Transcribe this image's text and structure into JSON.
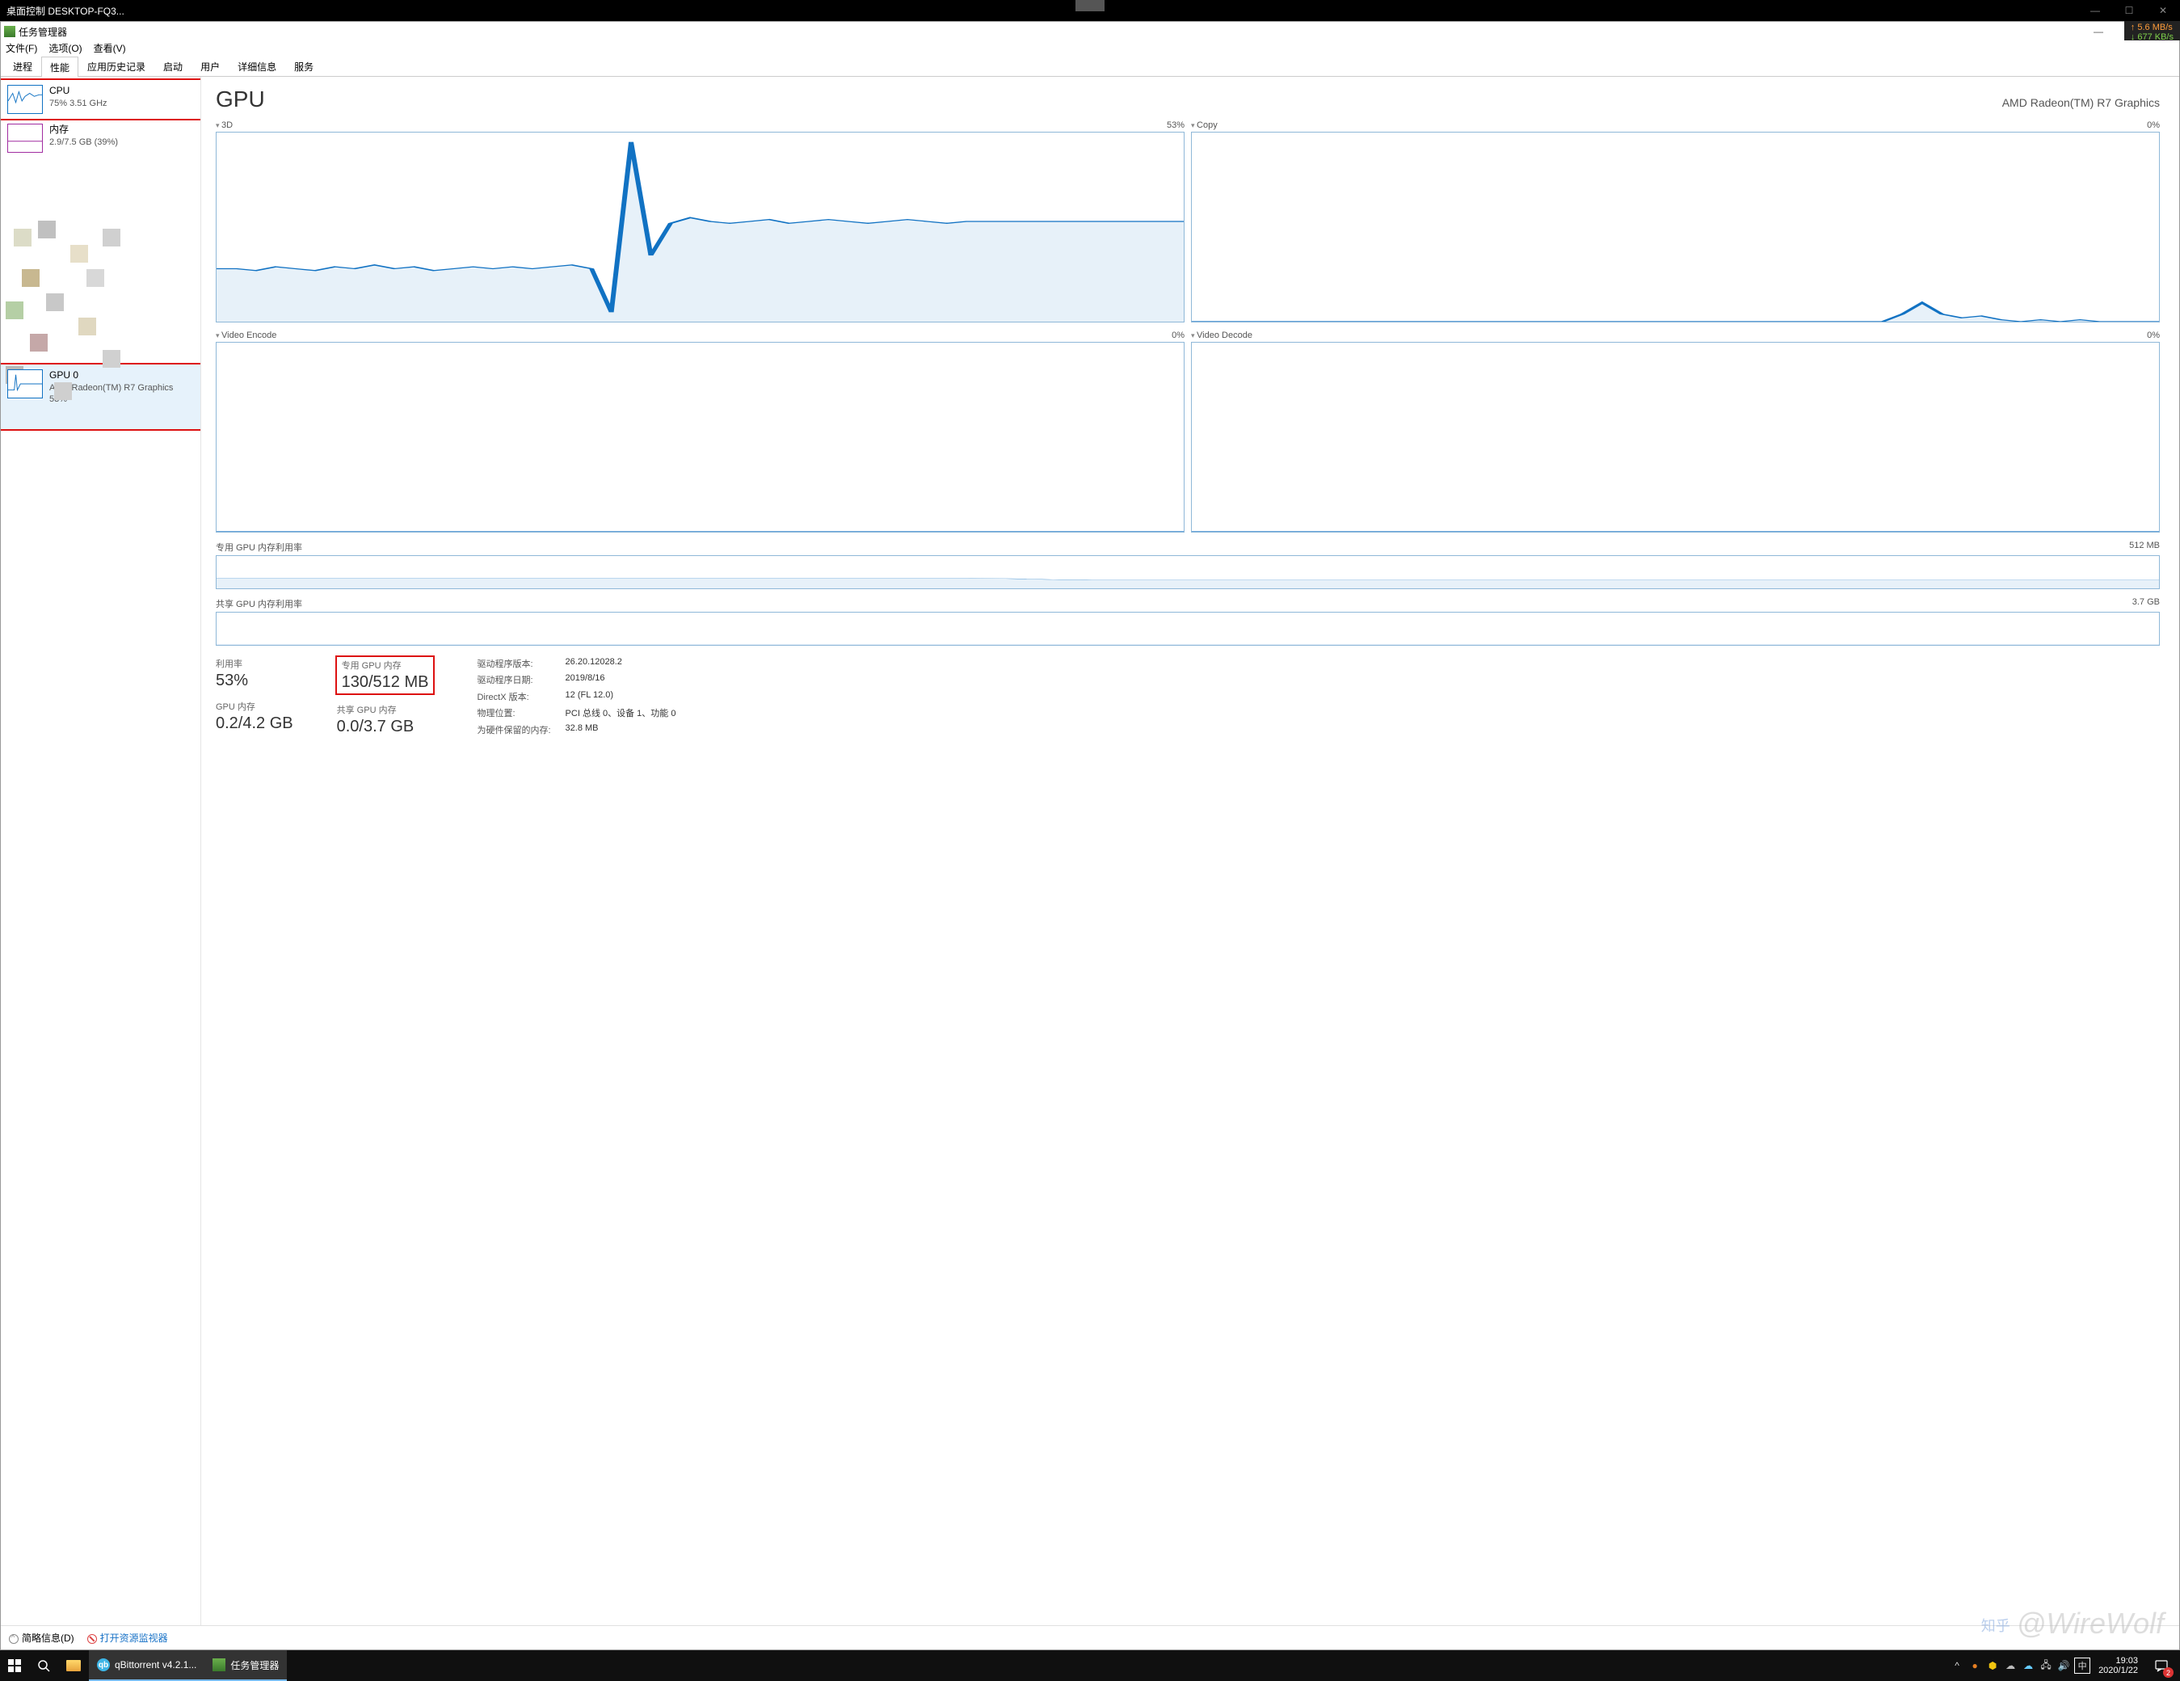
{
  "outer": {
    "title": "桌面控制 DESKTOP-FQ3...",
    "speed_up": "↑ 5.6 MB/s",
    "speed_down": "↓ 677 KB/s"
  },
  "tm": {
    "title": "任务管理器",
    "menu": [
      "文件(F)",
      "选项(O)",
      "查看(V)"
    ],
    "tabs": [
      "进程",
      "性能",
      "应用历史记录",
      "启动",
      "用户",
      "详细信息",
      "服务"
    ],
    "active_tab": 1
  },
  "sidebar": {
    "cpu": {
      "title": "CPU",
      "sub": "75% 3.51 GHz"
    },
    "mem": {
      "title": "内存",
      "sub": "2.9/7.5 GB (39%)"
    },
    "gpu": {
      "title": "GPU 0",
      "sub1": "AMD Radeon(TM) R7 Graphics",
      "sub2": "53%"
    }
  },
  "detail": {
    "title": "GPU",
    "device": "AMD Radeon(TM) R7 Graphics",
    "charts": [
      {
        "name": "3D",
        "pct": "53%"
      },
      {
        "name": "Copy",
        "pct": "0%"
      },
      {
        "name": "Video Encode",
        "pct": "0%"
      },
      {
        "name": "Video Decode",
        "pct": "0%"
      }
    ],
    "dedicated_mem": {
      "label": "专用 GPU 内存利用率",
      "max": "512 MB"
    },
    "shared_mem": {
      "label": "共享 GPU 内存利用率",
      "max": "3.7 GB"
    },
    "stats": {
      "util": {
        "label": "利用率",
        "value": "53%"
      },
      "dedicated": {
        "label": "专用 GPU 内存",
        "value": "130/512 MB"
      },
      "gpu_mem": {
        "label": "GPU 内存",
        "value": "0.2/4.2 GB"
      },
      "shared": {
        "label": "共享 GPU 内存",
        "value": "0.0/3.7 GB"
      },
      "pairs": [
        {
          "k": "驱动程序版本:",
          "v": "26.20.12028.2"
        },
        {
          "k": "驱动程序日期:",
          "v": "2019/8/16"
        },
        {
          "k": "DirectX 版本:",
          "v": "12 (FL 12.0)"
        },
        {
          "k": "物理位置:",
          "v": "PCI 总线 0、设备 1、功能 0"
        },
        {
          "k": "为硬件保留的内存:",
          "v": "32.8 MB"
        }
      ]
    }
  },
  "footer": {
    "fewer": "简略信息(D)",
    "monitor": "打开资源监视器"
  },
  "taskbar": {
    "apps": [
      {
        "name": "qBittorrent v4.2.1...",
        "icon": "qb"
      },
      {
        "name": "任务管理器",
        "icon": "tm"
      }
    ],
    "ime": "中",
    "time": "19:03",
    "date": "2020/1/22",
    "notif_count": "2"
  },
  "watermark": "@WireWolf",
  "watermark_prefix": "知乎",
  "chart_data": [
    {
      "type": "area",
      "title": "3D",
      "ylim": [
        0,
        100
      ],
      "ylabel": "%",
      "values": [
        28,
        28,
        27,
        29,
        28,
        27,
        29,
        28,
        30,
        28,
        29,
        27,
        28,
        29,
        28,
        29,
        28,
        29,
        30,
        28,
        5,
        95,
        35,
        52,
        55,
        53,
        52,
        53,
        54,
        52,
        53,
        54,
        53,
        52,
        53,
        54,
        53,
        52,
        53,
        53,
        53,
        53,
        53,
        53,
        53,
        53,
        53,
        53,
        53,
        53
      ]
    },
    {
      "type": "area",
      "title": "Copy",
      "ylim": [
        0,
        100
      ],
      "ylabel": "%",
      "values": [
        0,
        0,
        0,
        0,
        0,
        0,
        0,
        0,
        0,
        0,
        0,
        0,
        0,
        0,
        0,
        0,
        0,
        0,
        0,
        0,
        0,
        0,
        0,
        0,
        0,
        0,
        0,
        0,
        0,
        0,
        0,
        0,
        0,
        0,
        0,
        0,
        4,
        10,
        4,
        2,
        3,
        1,
        0,
        1,
        0,
        1,
        0,
        0,
        0,
        0
      ]
    },
    {
      "type": "area",
      "title": "Video Encode",
      "ylim": [
        0,
        100
      ],
      "ylabel": "%",
      "values": [
        0,
        0,
        0,
        0,
        0,
        0,
        0,
        0,
        0,
        0,
        0,
        0,
        0,
        0,
        0,
        0,
        0,
        0,
        0,
        0,
        0,
        0,
        0,
        0,
        0,
        0,
        0,
        0,
        0,
        0,
        0,
        0,
        0,
        0,
        0,
        0,
        0,
        0,
        0,
        0,
        0,
        0,
        0,
        0,
        0,
        0,
        0,
        0,
        0,
        0
      ]
    },
    {
      "type": "area",
      "title": "Video Decode",
      "ylim": [
        0,
        100
      ],
      "ylabel": "%",
      "values": [
        0,
        0,
        0,
        0,
        0,
        0,
        0,
        0,
        0,
        0,
        0,
        0,
        0,
        0,
        0,
        0,
        0,
        0,
        0,
        0,
        0,
        0,
        0,
        0,
        0,
        0,
        0,
        0,
        0,
        0,
        0,
        0,
        0,
        0,
        0,
        0,
        0,
        0,
        0,
        0,
        0,
        0,
        0,
        0,
        0,
        0,
        0,
        0,
        0,
        0
      ]
    },
    {
      "type": "area",
      "title": "专用 GPU 内存利用率",
      "ylim": [
        0,
        512
      ],
      "ylabel": "MB",
      "values": [
        160,
        160,
        160,
        160,
        160,
        160,
        160,
        160,
        160,
        160,
        160,
        160,
        160,
        160,
        160,
        160,
        160,
        160,
        160,
        160,
        155,
        140,
        130,
        130,
        130,
        130,
        130,
        130,
        130,
        130,
        130,
        130,
        130,
        130,
        130,
        130,
        130,
        130,
        130,
        130,
        130,
        130,
        130,
        130,
        130,
        130,
        130,
        130,
        130,
        130
      ]
    },
    {
      "type": "area",
      "title": "共享 GPU 内存利用率",
      "ylim": [
        0,
        3.7
      ],
      "ylabel": "GB",
      "values": [
        0,
        0,
        0,
        0,
        0,
        0,
        0,
        0,
        0,
        0,
        0,
        0,
        0,
        0,
        0,
        0,
        0,
        0,
        0,
        0,
        0,
        0,
        0,
        0,
        0,
        0,
        0,
        0,
        0,
        0,
        0,
        0,
        0,
        0,
        0,
        0,
        0,
        0,
        0,
        0,
        0,
        0,
        0,
        0,
        0,
        0,
        0,
        0,
        0,
        0
      ]
    }
  ]
}
